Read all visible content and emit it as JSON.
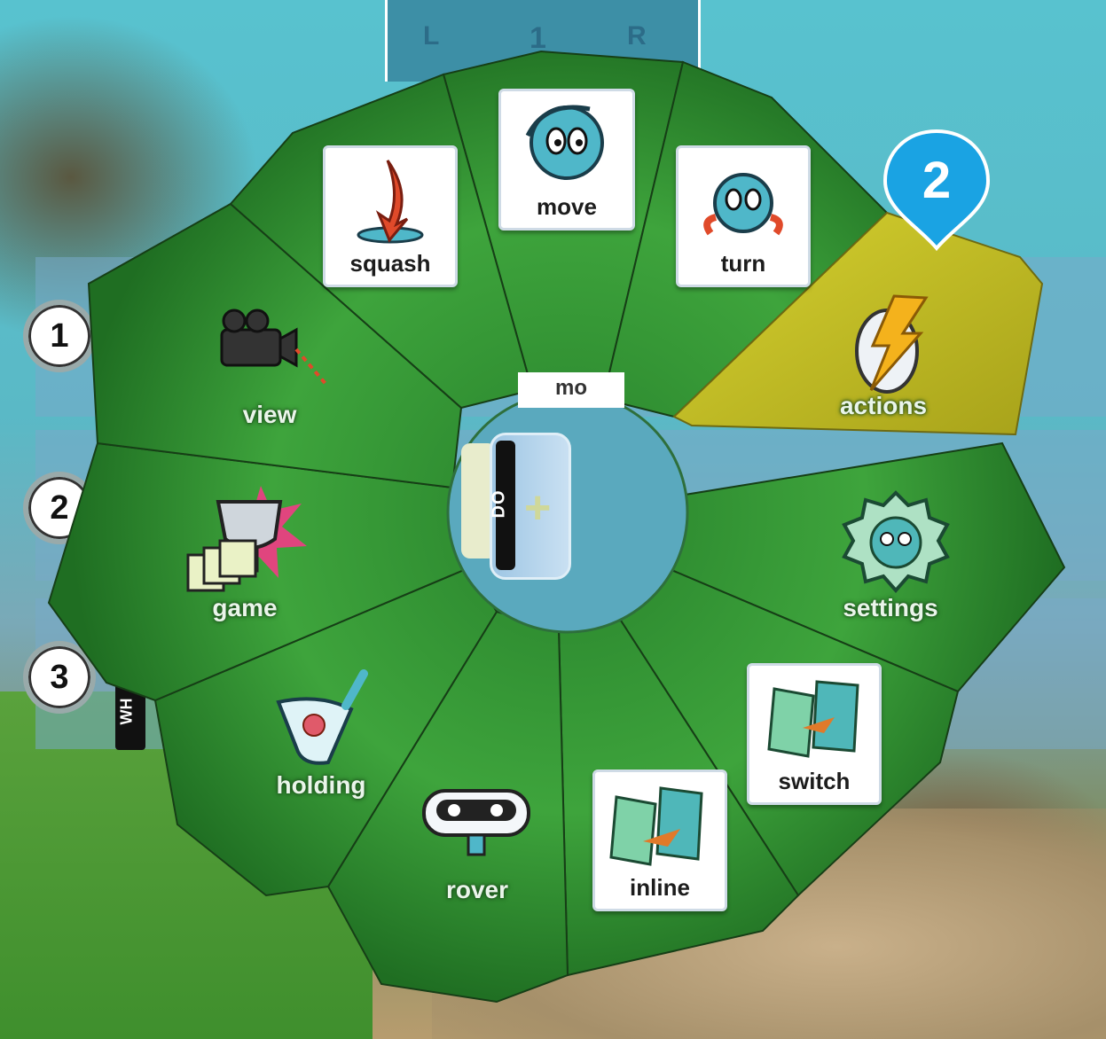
{
  "top_bar": {
    "left_label": "L",
    "right_label": "R",
    "page_number": "1"
  },
  "rows": [
    {
      "number": "1"
    },
    {
      "number": "2"
    },
    {
      "number": "3"
    }
  ],
  "side_tag": "WH",
  "hub": {
    "label": "DO",
    "partial_label": "mo"
  },
  "menu": {
    "items": [
      {
        "label": "move",
        "icon": "move-icon",
        "tile": true
      },
      {
        "label": "turn",
        "icon": "turn-icon",
        "tile": true
      },
      {
        "label": "actions",
        "icon": "lightning-egg-icon",
        "tile": false,
        "selected": true
      },
      {
        "label": "settings",
        "icon": "gear-face-icon",
        "tile": false
      },
      {
        "label": "switch",
        "icon": "switch-pages-icon",
        "tile": true
      },
      {
        "label": "inline",
        "icon": "inline-pages-icon",
        "tile": true
      },
      {
        "label": "rover",
        "icon": "rover-robot-icon",
        "tile": false
      },
      {
        "label": "holding",
        "icon": "holding-net-icon",
        "tile": false
      },
      {
        "label": "game",
        "icon": "trophy-icon",
        "tile": false
      },
      {
        "label": "view",
        "icon": "video-camera-icon",
        "tile": false
      },
      {
        "label": "squash",
        "icon": "squash-arrow-icon",
        "tile": true
      }
    ]
  },
  "badge": {
    "number": "2"
  },
  "colors": {
    "wedge_green": "#3a9a3a",
    "wedge_selected": "#c6c12a",
    "badge_blue": "#1aa3e3"
  }
}
